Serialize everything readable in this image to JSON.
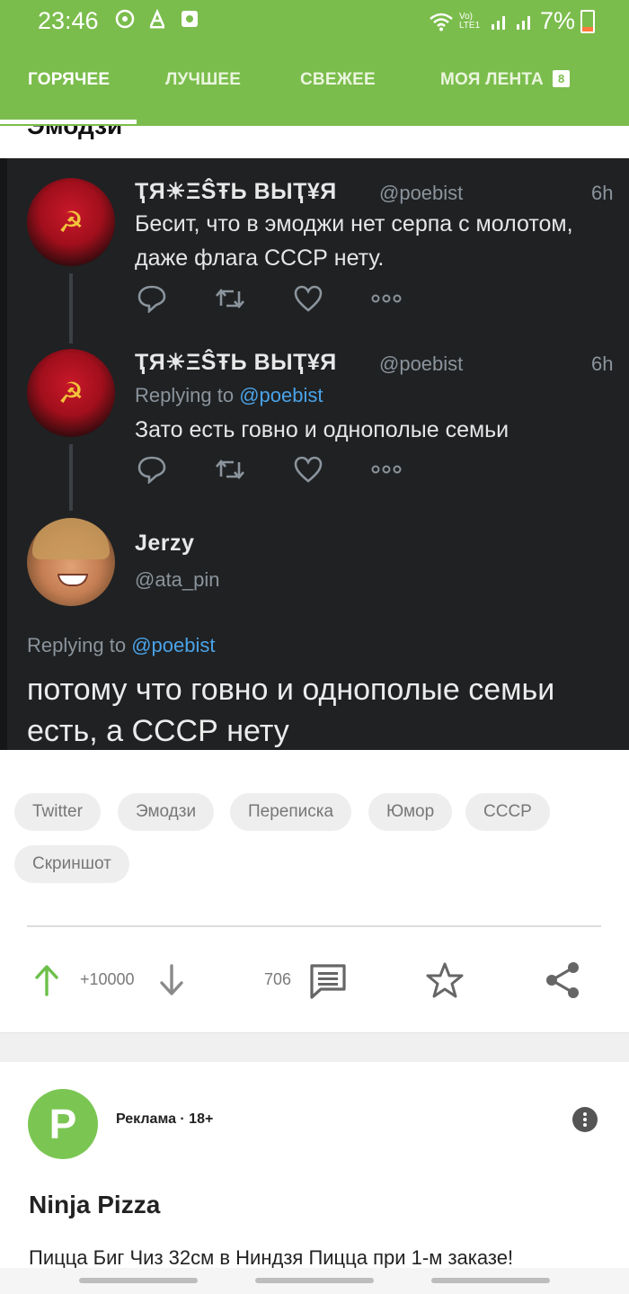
{
  "status_bar": {
    "time": "23:46",
    "left_icons": [
      "sync-icon",
      "text-a-icon",
      "app-icon"
    ],
    "network_label": "Vo) LTE1",
    "battery_percent": "7%"
  },
  "tabs": [
    {
      "label": "ГОРЯЧЕЕ",
      "active": true
    },
    {
      "label": "ЛУЧШЕЕ",
      "active": false
    },
    {
      "label": "СВЕЖЕЕ",
      "active": false
    },
    {
      "label": "МОЯ ЛЕНТА",
      "active": false,
      "badge": "8"
    }
  ],
  "post": {
    "cut_title": "Эмодзи"
  },
  "tweets": [
    {
      "name": "ҬЯ☀ΞŜŦЬ ВЫҬ¥Я",
      "handle": "@poebist",
      "time": "6h",
      "text": "Бесит, что в эмоджи нет серпа с молотом, даже флага СССР нету."
    },
    {
      "name": "ҬЯ☀ΞŜŦЬ ВЫҬ¥Я",
      "handle": "@poebist",
      "time": "6h",
      "reply_prefix": "Replying to ",
      "reply_to": "@poebist",
      "text": "Зато есть говно и однополые семьи"
    },
    {
      "name": "Jerzy",
      "handle": "@ata_pin",
      "reply_prefix": "Replying to ",
      "reply_to": "@poebist",
      "text": "потому что говно и однополые семьи есть, а СССР нету"
    }
  ],
  "tags": [
    "Twitter",
    "Эмодзи",
    "Переписка",
    "Юмор",
    "СССР",
    "Скриншот"
  ],
  "actions": {
    "rating": "+10000",
    "comments": "706"
  },
  "ad": {
    "logo_letter": "P",
    "meta": "Реклама · 18+",
    "title": "Ninja Pizza",
    "description": "Пицца Биг Чиз 32см в Ниндзя Пицца при 1-м заказе!"
  },
  "colors": {
    "brand_green": "#7bbd4c",
    "tweet_bg": "#1f2123",
    "link_blue": "#4aa3e8",
    "upvote_green": "#6cc04a"
  }
}
